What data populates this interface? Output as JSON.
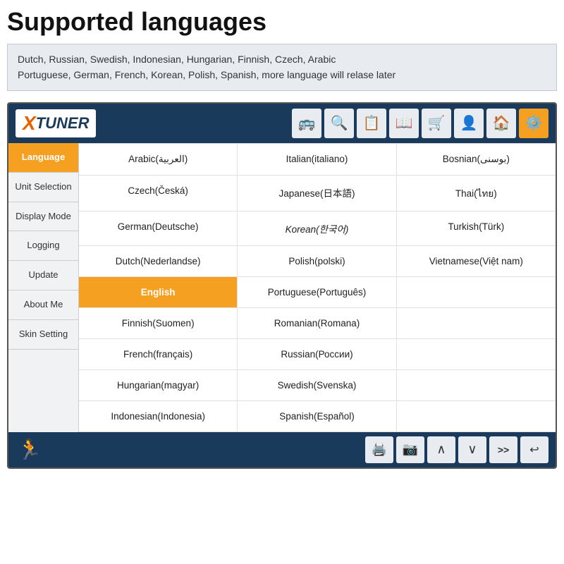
{
  "page": {
    "title": "Supported languages",
    "subtitle": "Dutch, Russian, Swedish, Indonesian, Hungarian, Finnish, Czech, Arabic\nPortuguese, German, French, Korean, Polish, Spanish, more language will relase later"
  },
  "app": {
    "logo_x": "X",
    "logo_tuner": "TUNER",
    "top_icons": [
      "🚌",
      "🔍",
      "📋",
      "📖",
      "🛒",
      "👤",
      "🏠",
      "⚙️"
    ],
    "sidebar_items": [
      {
        "label": "Language",
        "active": true
      },
      {
        "label": "Unit Selection",
        "active": false
      },
      {
        "label": "Display Mode",
        "active": false
      },
      {
        "label": "Logging",
        "active": false
      },
      {
        "label": "Update",
        "active": false
      },
      {
        "label": "About Me",
        "active": false
      },
      {
        "label": "Skin Setting",
        "active": false
      }
    ],
    "languages": [
      {
        "name": "Arabic(العربية)",
        "selected": false
      },
      {
        "name": "Italian(italiano)",
        "selected": false
      },
      {
        "name": "Bosnian(بوسنی)",
        "selected": false
      },
      {
        "name": "Czech(Česká)",
        "selected": false
      },
      {
        "name": "Japanese(日本語)",
        "selected": false
      },
      {
        "name": "Thai(ไทย)",
        "selected": false
      },
      {
        "name": "German(Deutsche)",
        "selected": false
      },
      {
        "name": "Korean(한국어)",
        "selected": false
      },
      {
        "name": "Turkish(Türk)",
        "selected": false
      },
      {
        "name": "Dutch(Nederlandse)",
        "selected": false
      },
      {
        "name": "Polish(polski)",
        "selected": false
      },
      {
        "name": "Vietnamese(Việt nam)",
        "selected": false
      },
      {
        "name": "English",
        "selected": true
      },
      {
        "name": "Portuguese(Português)",
        "selected": false
      },
      {
        "name": "",
        "selected": false
      },
      {
        "name": "Finnish(Suomen)",
        "selected": false
      },
      {
        "name": "Romanian(Romana)",
        "selected": false
      },
      {
        "name": "",
        "selected": false
      },
      {
        "name": "French(français)",
        "selected": false
      },
      {
        "name": "Russian(России)",
        "selected": false
      },
      {
        "name": "",
        "selected": false
      },
      {
        "name": "Hungarian(magyar)",
        "selected": false
      },
      {
        "name": "Swedish(Svenska)",
        "selected": false
      },
      {
        "name": "",
        "selected": false
      },
      {
        "name": "Indonesian(Indonesia)",
        "selected": false
      },
      {
        "name": "Spanish(Español)",
        "selected": false
      },
      {
        "name": "",
        "selected": false
      }
    ],
    "bottom_left_icon": "🏃",
    "bottom_icons": [
      "🖨️",
      "📷",
      "∧",
      "∨",
      "»",
      "↩"
    ]
  }
}
